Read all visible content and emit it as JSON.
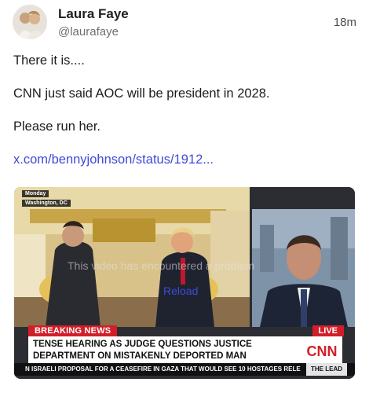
{
  "post": {
    "author_name": "Laura Faye",
    "author_handle": "@laurafaye",
    "timestamp": "18m",
    "lines": [
      "There it is....",
      "CNN just said AOC will be president in 2028.",
      "Please run her."
    ],
    "link_text": "x.com/bennyjohnson/status/1912..."
  },
  "video": {
    "location_day": "Monday",
    "location_city": "Washington, DC",
    "error_text": "This video has encountered a problem",
    "reload_label": "Reload",
    "breaking_label": "BREAKING NEWS",
    "live_label": "LIVE",
    "headline_line1": "TENSE HEARING AS JUDGE QUESTIONS JUSTICE",
    "headline_line2": "DEPARTMENT ON MISTAKENLY DEPORTED MAN",
    "ticker_text": "N ISRAELI PROPOSAL FOR A CEASEFIRE IN GAZA THAT WOULD SEE 10 HOSTAGES RELE",
    "ticker_tag": "THE LEAD",
    "logo_text": "CNN"
  },
  "colors": {
    "link": "#3e4bd8",
    "breaking_red": "#d11f2a"
  }
}
